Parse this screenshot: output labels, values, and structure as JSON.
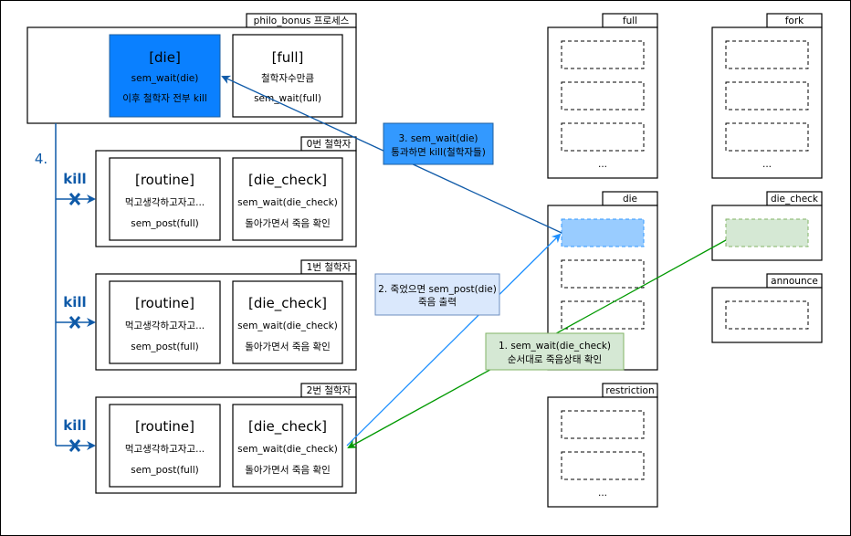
{
  "colors": {
    "die_fill": "#0a80ff",
    "label3_fill": "#3399ff",
    "label2_fill": "#dae8fc",
    "label1_fill": "#d5e8d4",
    "kill_line": "#0f5aa8",
    "post_line": "#1e90ff",
    "check_line": "#009900",
    "die_slot_fill": "#99ccff",
    "die_check_slot_fill": "#d5e8d4"
  },
  "process": {
    "tab": "philo_bonus 프로세스",
    "die": {
      "title": "[die]",
      "line1": "sem_wait(die)",
      "line2": "이후 철학자 전부 kill"
    },
    "full": {
      "title": "[full]",
      "line1": "철학자수만큼",
      "line2": "sem_wait(full)"
    }
  },
  "philosophers": [
    {
      "tab": "0번 철학자",
      "routine": {
        "title": "[routine]",
        "line1": "먹고생각하고자고...",
        "line2": "sem_post(full)"
      },
      "check": {
        "title": "[die_check]",
        "line1": "sem_wait(die_check)",
        "line2": "돌아가면서 죽음 확인"
      },
      "kill": "kill"
    },
    {
      "tab": "1번 철학자",
      "routine": {
        "title": "[routine]",
        "line1": "먹고생각하고자고...",
        "line2": "sem_post(full)"
      },
      "check": {
        "title": "[die_check]",
        "line1": "sem_wait(die_check)",
        "line2": "돌아가면서 죽음 확인"
      },
      "kill": "kill"
    },
    {
      "tab": "2번 철학자",
      "routine": {
        "title": "[routine]",
        "line1": "먹고생각하고자고...",
        "line2": "sem_post(full)"
      },
      "check": {
        "title": "[die_check]",
        "line1": "sem_wait(die_check)",
        "line2": "돌아가면서 죽음 확인"
      },
      "kill": "kill"
    }
  ],
  "step4": "4.",
  "semaphores": {
    "full": "full",
    "fork": "fork",
    "die": "die",
    "die_check": "die_check",
    "announce": "announce",
    "restriction": "restriction",
    "ellipsis": "..."
  },
  "labels": {
    "step3": {
      "line1": "3. sem_wait(die)",
      "line2": "통과하면 kill(철학자들)"
    },
    "step2": {
      "line1": "2. 죽었으면 sem_post(die)",
      "line2": "죽음 출력"
    },
    "step1": {
      "line1": "1. sem_wait(die_check)",
      "line2": "순서대로 죽음상태 확인"
    }
  }
}
